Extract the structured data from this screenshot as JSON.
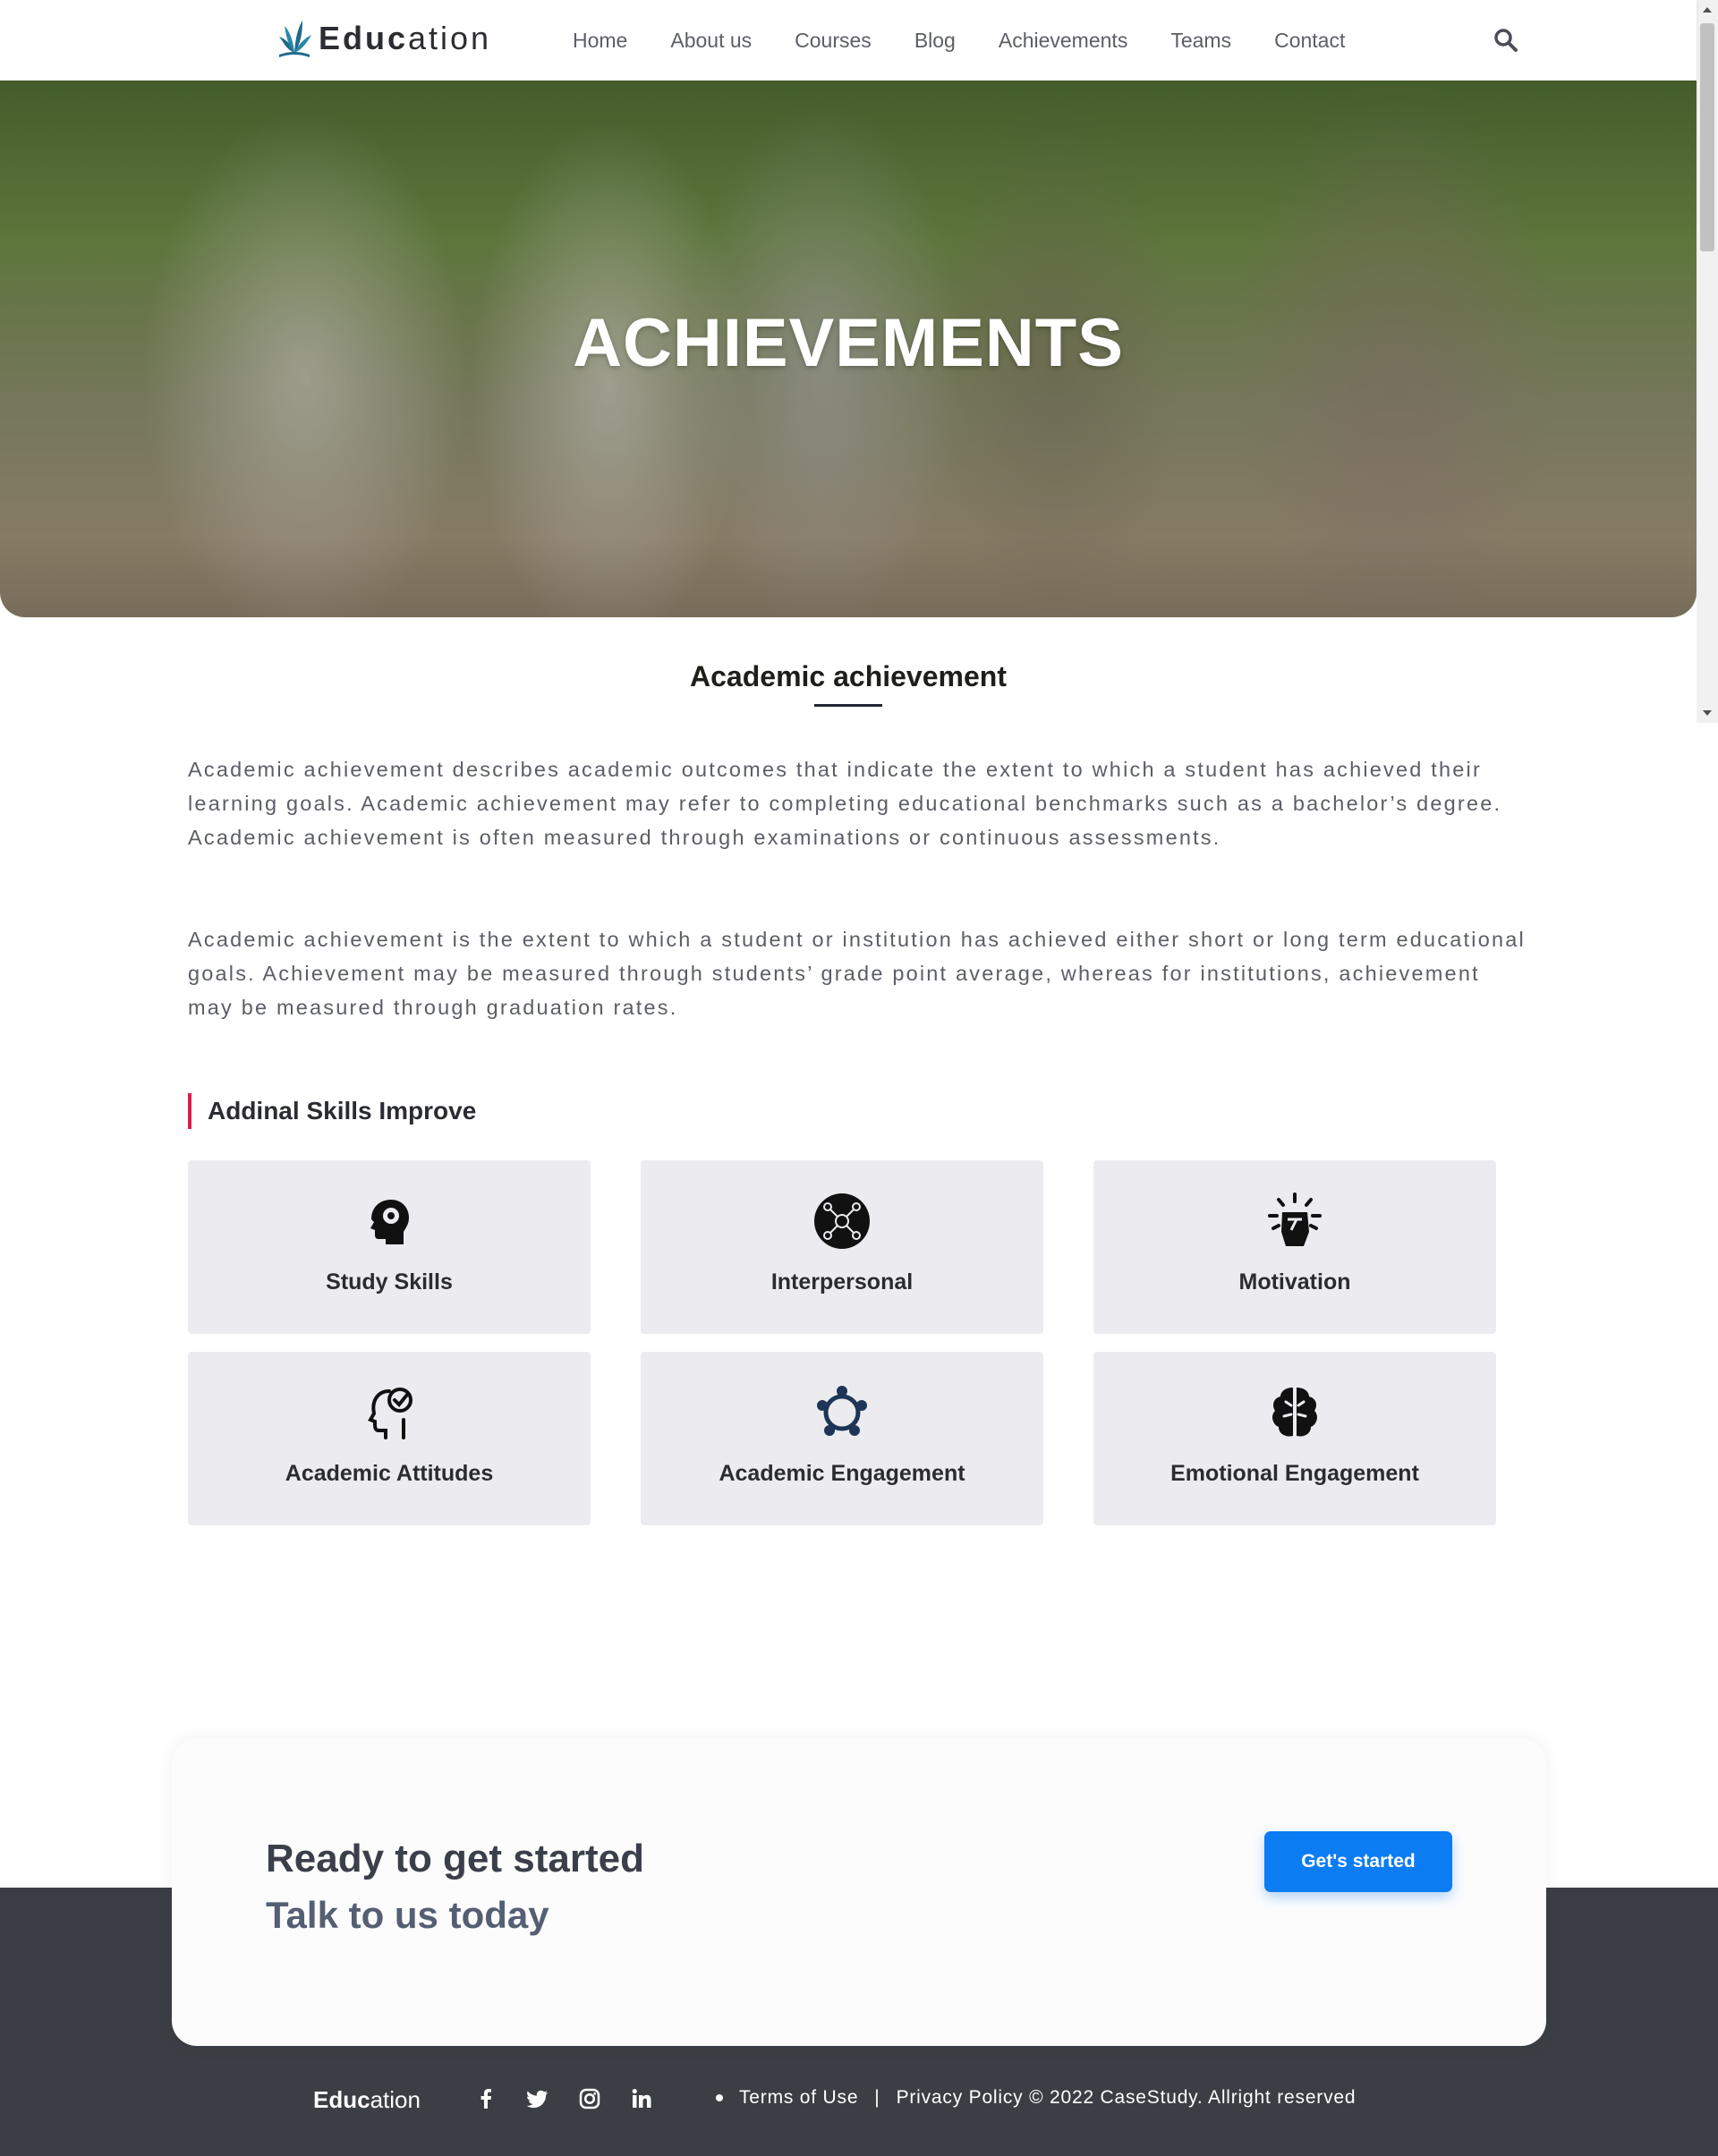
{
  "header": {
    "logo_bold": "Educ",
    "logo_light": "ation",
    "nav": [
      "Home",
      "About us",
      "Courses",
      "Blog",
      "Achievements",
      "Teams",
      "Contact"
    ],
    "search_icon": "search-icon"
  },
  "hero": {
    "title": "ACHIEVEMENTS"
  },
  "section": {
    "title": "Academic achievement",
    "paragraphs": [
      "Academic achievement describes academic outcomes that indicate the extent to which a student has achieved their learning goals. Academic achievement may refer to completing educational benchmarks such as a bachelor’s degree. Academic achievement is often measured through examinations or continuous assessments.",
      "Academic achievement is the extent to which a student or institution has achieved either short or long term educational goals. Achievement may be measured through students’ grade point average, whereas for institutions, achievement may be measured through graduation rates."
    ]
  },
  "skills": {
    "heading": "Addinal Skills Improve",
    "cards": [
      {
        "label": "Study Skills",
        "icon": "head-gear-icon"
      },
      {
        "label": "Interpersonal",
        "icon": "network-circle-icon"
      },
      {
        "label": "Motivation",
        "icon": "fist-burst-icon"
      },
      {
        "label": "Academic Attitudes",
        "icon": "head-check-icon"
      },
      {
        "label": "Academic Engagement",
        "icon": "people-circle-icon"
      },
      {
        "label": "Emotional Engagement",
        "icon": "brain-icon"
      }
    ]
  },
  "cta": {
    "line1": "Ready to get started",
    "line2": "Talk to us today",
    "button": "Get's started"
  },
  "footer": {
    "logo_bold": "Educ",
    "logo_light": "ation",
    "socials": [
      "facebook-icon",
      "twitter-icon",
      "instagram-icon",
      "linkedin-icon"
    ],
    "terms": "Terms of Use",
    "separator": "|",
    "privacy": "Privacy Policy © 2022 CaseStudy.  Allright reserved"
  },
  "colors": {
    "accent": "#0c7cf2",
    "heading_bar": "#e0194f",
    "footer_bg": "#3b3e44",
    "card_bg": "#ececf0"
  }
}
